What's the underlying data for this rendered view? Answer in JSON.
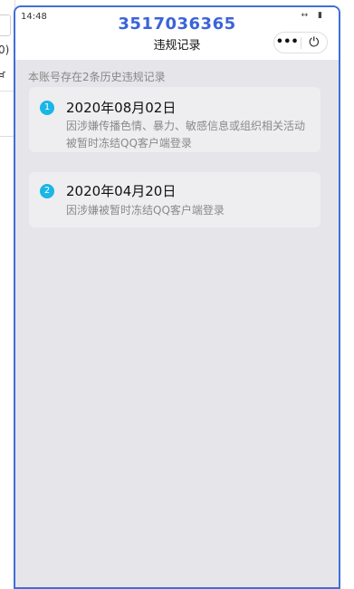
{
  "status_bar": {
    "time": "14:48",
    "icon_network": "↔",
    "icon_battery": "▮"
  },
  "header": {
    "app_title": "3517036365",
    "page_title": "违规记录",
    "more_label": "•••",
    "power_label": "⏻"
  },
  "background_window": {
    "text1": "0)",
    "text2": "ਖ"
  },
  "summary": "本账号存在2条历史违规记录",
  "records": [
    {
      "index": "1",
      "date": "2020年08月02日",
      "description": "因涉嫌传播色情、暴力、敏感信息或组织相关活动被暂时冻结QQ客户端登录"
    },
    {
      "index": "2",
      "date": "2020年04月20日",
      "description": "因涉嫌被暂时冻结QQ客户端登录"
    }
  ],
  "colors": {
    "accent": "#3b64d8",
    "badge": "#19b6e6",
    "background": "#e5e5ea",
    "frame": "#3f6fd6"
  }
}
